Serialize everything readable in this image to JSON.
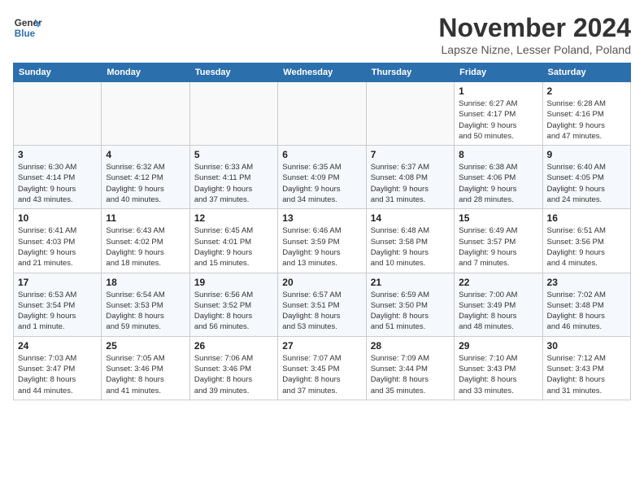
{
  "header": {
    "logo_line1": "General",
    "logo_line2": "Blue",
    "month": "November 2024",
    "location": "Lapsze Nizne, Lesser Poland, Poland"
  },
  "days_of_week": [
    "Sunday",
    "Monday",
    "Tuesday",
    "Wednesday",
    "Thursday",
    "Friday",
    "Saturday"
  ],
  "weeks": [
    [
      {
        "day": "",
        "info": ""
      },
      {
        "day": "",
        "info": ""
      },
      {
        "day": "",
        "info": ""
      },
      {
        "day": "",
        "info": ""
      },
      {
        "day": "",
        "info": ""
      },
      {
        "day": "1",
        "info": "Sunrise: 6:27 AM\nSunset: 4:17 PM\nDaylight: 9 hours\nand 50 minutes."
      },
      {
        "day": "2",
        "info": "Sunrise: 6:28 AM\nSunset: 4:16 PM\nDaylight: 9 hours\nand 47 minutes."
      }
    ],
    [
      {
        "day": "3",
        "info": "Sunrise: 6:30 AM\nSunset: 4:14 PM\nDaylight: 9 hours\nand 43 minutes."
      },
      {
        "day": "4",
        "info": "Sunrise: 6:32 AM\nSunset: 4:12 PM\nDaylight: 9 hours\nand 40 minutes."
      },
      {
        "day": "5",
        "info": "Sunrise: 6:33 AM\nSunset: 4:11 PM\nDaylight: 9 hours\nand 37 minutes."
      },
      {
        "day": "6",
        "info": "Sunrise: 6:35 AM\nSunset: 4:09 PM\nDaylight: 9 hours\nand 34 minutes."
      },
      {
        "day": "7",
        "info": "Sunrise: 6:37 AM\nSunset: 4:08 PM\nDaylight: 9 hours\nand 31 minutes."
      },
      {
        "day": "8",
        "info": "Sunrise: 6:38 AM\nSunset: 4:06 PM\nDaylight: 9 hours\nand 28 minutes."
      },
      {
        "day": "9",
        "info": "Sunrise: 6:40 AM\nSunset: 4:05 PM\nDaylight: 9 hours\nand 24 minutes."
      }
    ],
    [
      {
        "day": "10",
        "info": "Sunrise: 6:41 AM\nSunset: 4:03 PM\nDaylight: 9 hours\nand 21 minutes."
      },
      {
        "day": "11",
        "info": "Sunrise: 6:43 AM\nSunset: 4:02 PM\nDaylight: 9 hours\nand 18 minutes."
      },
      {
        "day": "12",
        "info": "Sunrise: 6:45 AM\nSunset: 4:01 PM\nDaylight: 9 hours\nand 15 minutes."
      },
      {
        "day": "13",
        "info": "Sunrise: 6:46 AM\nSunset: 3:59 PM\nDaylight: 9 hours\nand 13 minutes."
      },
      {
        "day": "14",
        "info": "Sunrise: 6:48 AM\nSunset: 3:58 PM\nDaylight: 9 hours\nand 10 minutes."
      },
      {
        "day": "15",
        "info": "Sunrise: 6:49 AM\nSunset: 3:57 PM\nDaylight: 9 hours\nand 7 minutes."
      },
      {
        "day": "16",
        "info": "Sunrise: 6:51 AM\nSunset: 3:56 PM\nDaylight: 9 hours\nand 4 minutes."
      }
    ],
    [
      {
        "day": "17",
        "info": "Sunrise: 6:53 AM\nSunset: 3:54 PM\nDaylight: 9 hours\nand 1 minute."
      },
      {
        "day": "18",
        "info": "Sunrise: 6:54 AM\nSunset: 3:53 PM\nDaylight: 8 hours\nand 59 minutes."
      },
      {
        "day": "19",
        "info": "Sunrise: 6:56 AM\nSunset: 3:52 PM\nDaylight: 8 hours\nand 56 minutes."
      },
      {
        "day": "20",
        "info": "Sunrise: 6:57 AM\nSunset: 3:51 PM\nDaylight: 8 hours\nand 53 minutes."
      },
      {
        "day": "21",
        "info": "Sunrise: 6:59 AM\nSunset: 3:50 PM\nDaylight: 8 hours\nand 51 minutes."
      },
      {
        "day": "22",
        "info": "Sunrise: 7:00 AM\nSunset: 3:49 PM\nDaylight: 8 hours\nand 48 minutes."
      },
      {
        "day": "23",
        "info": "Sunrise: 7:02 AM\nSunset: 3:48 PM\nDaylight: 8 hours\nand 46 minutes."
      }
    ],
    [
      {
        "day": "24",
        "info": "Sunrise: 7:03 AM\nSunset: 3:47 PM\nDaylight: 8 hours\nand 44 minutes."
      },
      {
        "day": "25",
        "info": "Sunrise: 7:05 AM\nSunset: 3:46 PM\nDaylight: 8 hours\nand 41 minutes."
      },
      {
        "day": "26",
        "info": "Sunrise: 7:06 AM\nSunset: 3:46 PM\nDaylight: 8 hours\nand 39 minutes."
      },
      {
        "day": "27",
        "info": "Sunrise: 7:07 AM\nSunset: 3:45 PM\nDaylight: 8 hours\nand 37 minutes."
      },
      {
        "day": "28",
        "info": "Sunrise: 7:09 AM\nSunset: 3:44 PM\nDaylight: 8 hours\nand 35 minutes."
      },
      {
        "day": "29",
        "info": "Sunrise: 7:10 AM\nSunset: 3:43 PM\nDaylight: 8 hours\nand 33 minutes."
      },
      {
        "day": "30",
        "info": "Sunrise: 7:12 AM\nSunset: 3:43 PM\nDaylight: 8 hours\nand 31 minutes."
      }
    ]
  ]
}
